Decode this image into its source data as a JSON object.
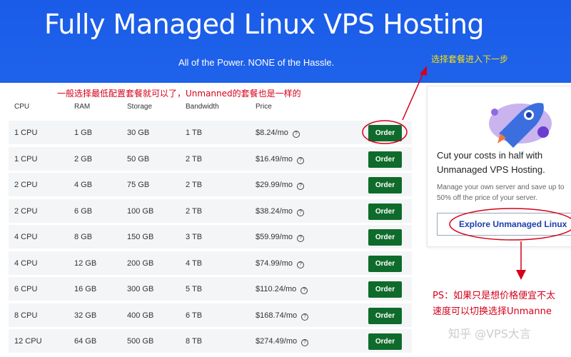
{
  "hero": {
    "title": "Fully Managed Linux VPS Hosting",
    "subtitle": "All of the Power. NONE of the Hassle."
  },
  "table": {
    "headers": [
      "CPU",
      "RAM",
      "Storage",
      "Bandwidth",
      "Price"
    ],
    "order_label": "Order",
    "rows": [
      {
        "cpu": "1 CPU",
        "ram": "1 GB",
        "storage": "30 GB",
        "bandwidth": "1 TB",
        "price": "$8.24/mo"
      },
      {
        "cpu": "1 CPU",
        "ram": "2 GB",
        "storage": "50 GB",
        "bandwidth": "2 TB",
        "price": "$16.49/mo"
      },
      {
        "cpu": "2 CPU",
        "ram": "4 GB",
        "storage": "75 GB",
        "bandwidth": "2 TB",
        "price": "$29.99/mo"
      },
      {
        "cpu": "2 CPU",
        "ram": "6 GB",
        "storage": "100 GB",
        "bandwidth": "2 TB",
        "price": "$38.24/mo"
      },
      {
        "cpu": "4 CPU",
        "ram": "8 GB",
        "storage": "150 GB",
        "bandwidth": "3 TB",
        "price": "$59.99/mo"
      },
      {
        "cpu": "4 CPU",
        "ram": "12 GB",
        "storage": "200 GB",
        "bandwidth": "4 TB",
        "price": "$74.99/mo"
      },
      {
        "cpu": "6 CPU",
        "ram": "16 GB",
        "storage": "300 GB",
        "bandwidth": "5 TB",
        "price": "$110.24/mo"
      },
      {
        "cpu": "8 CPU",
        "ram": "32 GB",
        "storage": "400 GB",
        "bandwidth": "6 TB",
        "price": "$168.74/mo"
      },
      {
        "cpu": "12 CPU",
        "ram": "64 GB",
        "storage": "500 GB",
        "bandwidth": "8 TB",
        "price": "$274.49/mo"
      }
    ]
  },
  "side_card": {
    "heading": "Cut your costs in half with Unmanaged VPS Hosting.",
    "body": "Manage your own server and save up to 50% off the price of your server.",
    "button_label": "Explore Unmanaged Linux"
  },
  "annotations": {
    "top_note": "一般选择最低配置套餐就可以了，Unmanned的套餐也是一样的",
    "step_note": "选择套餐进入下一步",
    "ps_line1": "PS：如果只是想价格便宜不太",
    "ps_line2": "速度可以切换选择Unmanne",
    "watermark": "知乎 @VPS大言"
  },
  "colors": {
    "hero_blue": "#1f62ea",
    "order_green": "#0f6b2b",
    "annotation_red": "#d4001a",
    "annotation_yellow": "#f5e20c"
  }
}
